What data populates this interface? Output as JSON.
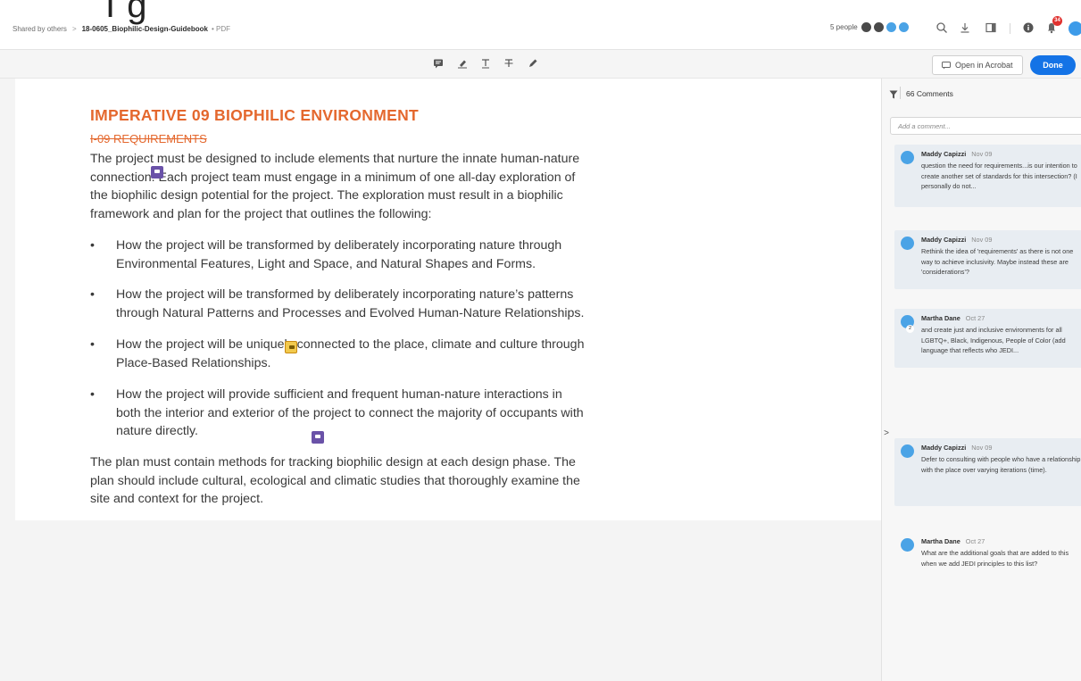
{
  "header": {
    "breadcrumb_root": "Shared by others",
    "breadcrumb_sep": ">",
    "file_name": "18-0605_Biophilic-Design-Guidebook",
    "file_kind": "• PDF",
    "peek_text": "I             g",
    "people_label": "5 people",
    "notifications_count": "34"
  },
  "toolbar": {
    "open_in_acrobat": "Open in Acrobat",
    "done": "Done"
  },
  "document": {
    "title": "IMPERATIVE 09 BIOPHILIC ENVIRONMENT",
    "subtitle": "I-09 REQUIREMENTS",
    "intro": [
      "The project must be designed to include elements that nurture the innate human-nature",
      "connection. Each project team must engage in a minimum of one all-day exploration of",
      "the biophilic design potential for the project. The exploration must result in a biophilic",
      "framework and plan for the project that outlines the following:"
    ],
    "bullet_char": "•",
    "bullets": [
      [
        "How the project will be transformed by deliberately incorporating nature through",
        "Environmental Features, Light and Space, and Natural Shapes and Forms."
      ],
      [
        "How the project will be transformed by deliberately incorporating nature’s patterns",
        "through Natural Patterns and Processes and Evolved Human-Nature Relationships."
      ],
      [
        "How the project will be uniquely connected to the place, climate and culture through",
        "Place-Based Relationships."
      ],
      [
        "How the project will provide sufficient and frequent human-nature interactions in",
        "both the interior and exterior of the project to connect the majority of occupants with",
        "nature directly."
      ]
    ],
    "closing": [
      "The plan must contain methods for tracking biophilic design at each design phase. The",
      "plan should include cultural, ecological and climatic studies that thoroughly examine the",
      "site and context for the project."
    ]
  },
  "comments_panel": {
    "count_label": "66 Comments",
    "add_placeholder": "Add a comment...",
    "collapse_glyph": ">",
    "comments": [
      {
        "author": "Maddy Capizzi",
        "date": "Nov 09",
        "text": "question the need for requirements...is our intention to create another set of standards for this intersection? (I personally do not..."
      },
      {
        "author": "Maddy Capizzi",
        "date": "Nov 09",
        "text": "Rethink the idea of 'requirements' as there is not one way to achieve inclusivity. Maybe instead these are 'considerations'?"
      },
      {
        "author": "Martha Dane",
        "date": "Oct 27",
        "reply_count": "2",
        "text": "and create just and inclusive environments for all LGBTQ+, Black, Indigenous, People of Color  (add language that reflects who JEDI..."
      },
      {
        "author": "Maddy Capizzi",
        "date": "Nov 09",
        "text": "Defer to consulting with people who have a relationship with the place over varying iterations (time)."
      },
      {
        "author": "Martha Dane",
        "date": "Oct 27",
        "text": "What are the additional goals that are added to this when we add JEDI principles to this list?"
      }
    ]
  }
}
